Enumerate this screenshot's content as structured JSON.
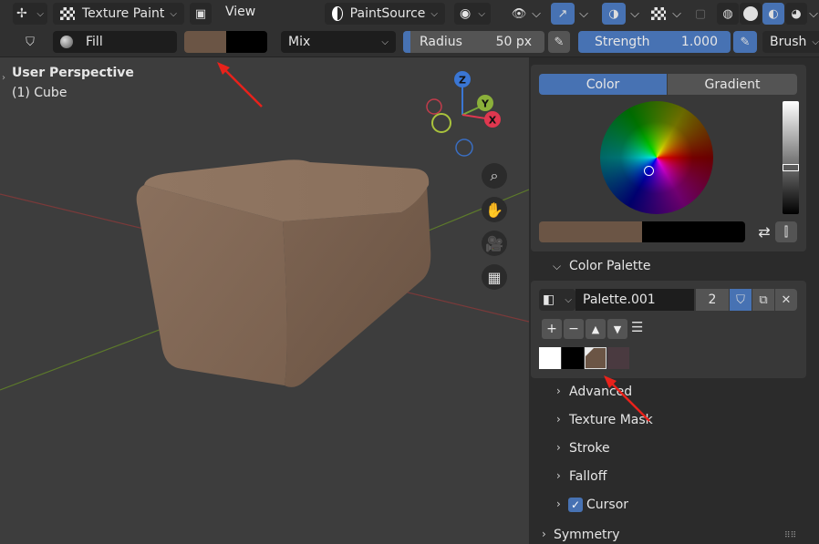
{
  "header": {
    "mode": "Texture Paint",
    "view_menu": "View",
    "source": "PaintSource"
  },
  "toolbar": {
    "fill_label": "Fill",
    "blend_mode": "Mix",
    "radius_label": "Radius",
    "radius_value": "50 px",
    "strength_label": "Strength",
    "strength_value": "1.000",
    "brush_label": "Brush",
    "primary_color": "#6b5545",
    "secondary_color": "#000000"
  },
  "viewport": {
    "perspective": "User Perspective",
    "object": "(1) Cube",
    "gizmo": {
      "x": "X",
      "y": "Y",
      "z": "Z"
    }
  },
  "panel": {
    "tabs": [
      "Color",
      "Gradient"
    ],
    "palette_section": "Color Palette",
    "palette_name": "Palette.001",
    "palette_users": "2",
    "swatches": [
      "#ffffff",
      "#000000",
      "#6b5545",
      "#4a3a40"
    ],
    "sections": [
      "Advanced",
      "Texture Mask",
      "Stroke",
      "Falloff",
      "Cursor",
      "Symmetry"
    ]
  },
  "colors": {
    "accent": "#4772b3",
    "annotation": "#e8221b"
  }
}
